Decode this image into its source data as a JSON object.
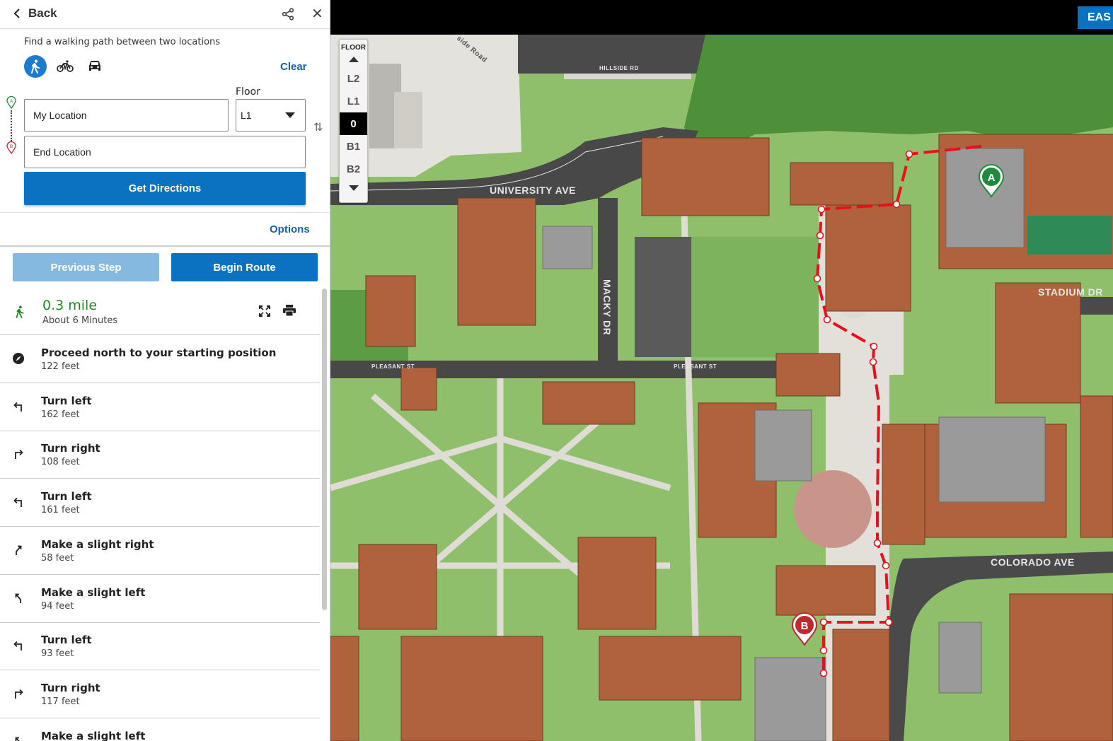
{
  "header": {
    "back_label": "Back"
  },
  "directions": {
    "hint": "Find a walking path between two locations",
    "modes": [
      "walk-icon",
      "bike-icon",
      "car-icon"
    ],
    "clear_label": "Clear",
    "floor_label": "Floor",
    "start_value": "My Location",
    "end_value": "End Location",
    "floor_value": "L1",
    "get_directions_label": "Get Directions",
    "options_label": "Options",
    "start_pin": "A",
    "end_pin": "B"
  },
  "route": {
    "prev_label": "Previous Step",
    "begin_label": "Begin Route",
    "distance": "0.3 mile",
    "duration": "About 6 Minutes",
    "steps": [
      {
        "title": "Proceed north to your starting position",
        "dist": "122 feet",
        "icon": "compass-icon"
      },
      {
        "title": "Turn left",
        "dist": "162 feet",
        "icon": "turn-left-icon"
      },
      {
        "title": "Turn right",
        "dist": "108 feet",
        "icon": "turn-right-icon"
      },
      {
        "title": "Turn left",
        "dist": "161 feet",
        "icon": "turn-left-icon"
      },
      {
        "title": "Make a slight right",
        "dist": "58 feet",
        "icon": "slight-right-icon"
      },
      {
        "title": "Make a slight left",
        "dist": "94 feet",
        "icon": "slight-left-icon"
      },
      {
        "title": "Turn left",
        "dist": "93 feet",
        "icon": "turn-left-icon"
      },
      {
        "title": "Turn right",
        "dist": "117 feet",
        "icon": "turn-right-icon"
      },
      {
        "title": "Make a slight left",
        "dist": "",
        "icon": "slight-left-icon"
      }
    ]
  },
  "map": {
    "east_label": "EAS",
    "floor_header": "FLOOR",
    "floors": [
      "L2",
      "L1",
      "0",
      "B1",
      "B2"
    ],
    "current_floor": "0",
    "street_labels": [
      "HILLSIDE RD",
      "UNIVERSITY AVE",
      "MACKY DR",
      "PLEASANT ST",
      "PLEASANT ST",
      "STADIUM DR",
      "COLORADO AVE",
      "side Road"
    ],
    "marker_a": "A",
    "marker_b": "B",
    "colors": {
      "route": "#e8101e",
      "marker_a": "#1f8a3a",
      "marker_b": "#c0282f",
      "accent": "#0a72c0"
    }
  }
}
